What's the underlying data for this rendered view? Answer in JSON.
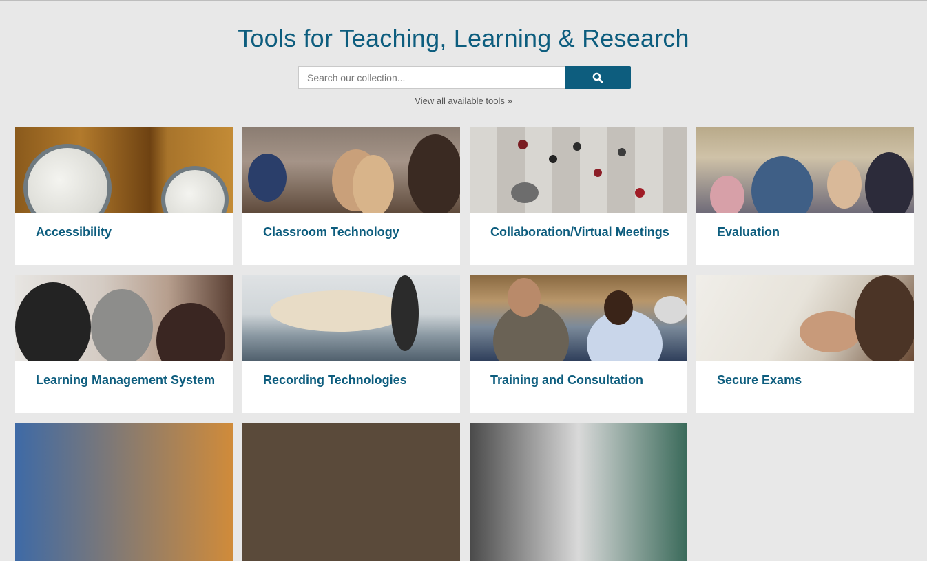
{
  "header": {
    "title": "Tools for Teaching, Learning & Research"
  },
  "search": {
    "placeholder": "Search our collection...",
    "button_icon": "search-icon"
  },
  "view_all_link": "View all available tools »",
  "cards": [
    {
      "label": "Accessibility"
    },
    {
      "label": "Classroom Technology"
    },
    {
      "label": "Collaboration/Virtual Meetings"
    },
    {
      "label": "Evaluation"
    },
    {
      "label": "Learning Management System"
    },
    {
      "label": "Recording Technologies"
    },
    {
      "label": "Training and Consultation"
    },
    {
      "label": "Secure Exams"
    }
  ],
  "colors": {
    "background": "#e8e8e8",
    "accent": "#0d5d7e",
    "card_background": "#ffffff"
  }
}
